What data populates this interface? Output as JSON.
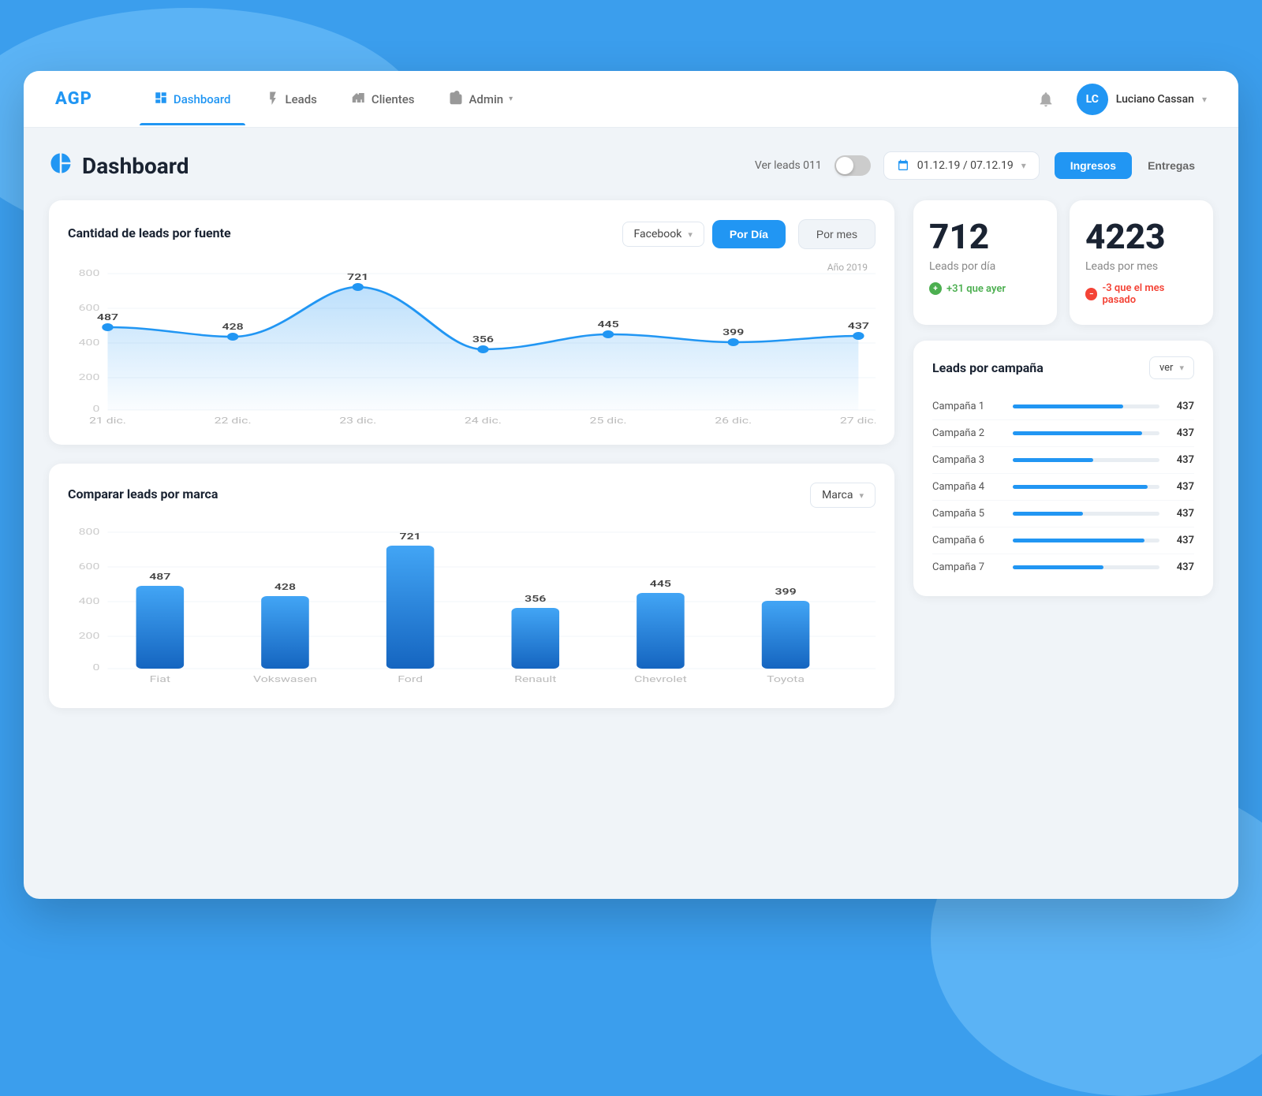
{
  "brand": {
    "logo": "AGP"
  },
  "nav": {
    "items": [
      {
        "label": "Dashboard",
        "icon": "📊",
        "active": true
      },
      {
        "label": "Leads",
        "icon": "⚡",
        "active": false
      },
      {
        "label": "Clientes",
        "icon": "🏢",
        "active": false
      },
      {
        "label": "Admin",
        "icon": "🗂",
        "active": false
      }
    ],
    "user": {
      "initials": "LC",
      "name": "Luciano Cassan"
    },
    "notification_icon": "🔔"
  },
  "dashboard": {
    "title": "Dashboard",
    "ver_leads_label": "Ver leads 011",
    "date_range": "01.12.19 / 07.12.19",
    "tab_ingresos": "Ingresos",
    "tab_entregas": "Entregas"
  },
  "stats": {
    "leads_dia": {
      "number": "712",
      "label": "Leads por día",
      "change": "+31 que ayer",
      "change_type": "positive"
    },
    "leads_mes": {
      "number": "4223",
      "label": "Leads por mes",
      "change": "-3 que el mes pasado",
      "change_type": "negative"
    }
  },
  "chart1": {
    "title": "Cantidad de leads por fuente",
    "source_label": "Facebook",
    "btn_dia": "Por Día",
    "btn_mes": "Por mes",
    "year_label": "Año 2019",
    "y_labels": [
      "800",
      "600",
      "400",
      "200",
      "0"
    ],
    "x_labels": [
      "21 dic.",
      "22 dic.",
      "23 dic.",
      "24 dic.",
      "25 dic.",
      "26 dic.",
      "27 dic."
    ],
    "data_points": [
      {
        "label": "21 dic.",
        "value": 487
      },
      {
        "label": "22 dic.",
        "value": 428
      },
      {
        "label": "23 dic.",
        "value": 721
      },
      {
        "label": "24 dic.",
        "value": 356
      },
      {
        "label": "25 dic.",
        "value": 445
      },
      {
        "label": "26 dic.",
        "value": 399
      },
      {
        "label": "27 dic.",
        "value": 437
      }
    ]
  },
  "chart2": {
    "title": "Comparar leads por marca",
    "dropdown_label": "Marca",
    "y_labels": [
      "800",
      "600",
      "400",
      "200",
      "0"
    ],
    "bars": [
      {
        "name": "Fiat",
        "value": 487,
        "height_pct": 60
      },
      {
        "name": "Vokswasen",
        "value": 428,
        "height_pct": 53
      },
      {
        "name": "Ford",
        "value": 721,
        "height_pct": 89
      },
      {
        "name": "Renault",
        "value": 356,
        "height_pct": 44
      },
      {
        "name": "Chevrolet",
        "value": 445,
        "height_pct": 55
      },
      {
        "name": "Toyota",
        "value": 399,
        "height_pct": 49
      }
    ]
  },
  "campaigns": {
    "title": "Leads por campaña",
    "dropdown_label": "ver",
    "items": [
      {
        "name": "Campaña 1",
        "value": 437,
        "pct": 75
      },
      {
        "name": "Campaña 2",
        "value": 437,
        "pct": 88
      },
      {
        "name": "Campaña 3",
        "value": 437,
        "pct": 55
      },
      {
        "name": "Campaña 4",
        "value": 437,
        "pct": 92
      },
      {
        "name": "Campaña 5",
        "value": 437,
        "pct": 48
      },
      {
        "name": "Campaña 6",
        "value": 437,
        "pct": 90
      },
      {
        "name": "Campaña 7",
        "value": 437,
        "pct": 62
      }
    ]
  }
}
